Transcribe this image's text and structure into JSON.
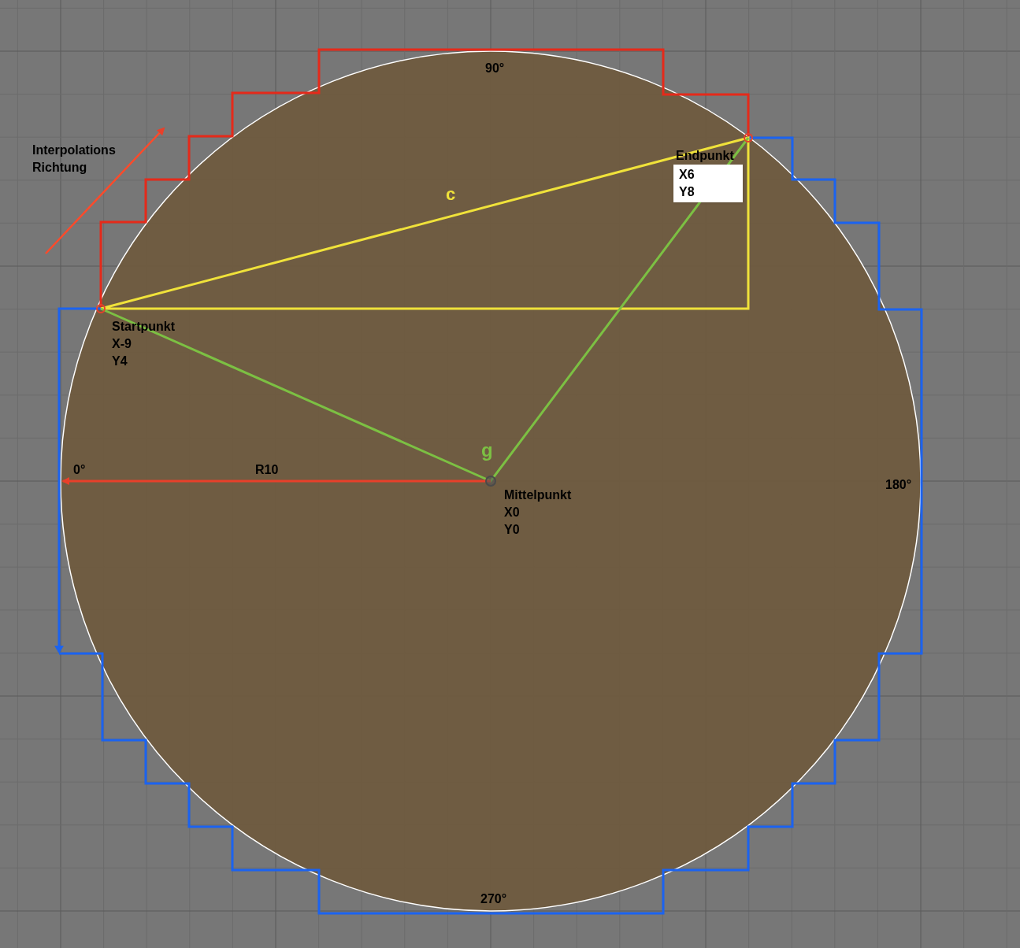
{
  "canvas": {
    "angle_labels": [
      "90°",
      "180°",
      "270°",
      "0°"
    ],
    "radius_label": "R10",
    "chord_label": "c",
    "angle_label": "g",
    "direction_label": [
      "Interpolations",
      "Richtung"
    ],
    "points": [
      {
        "kind": "start",
        "name": "Startpunkt",
        "x": "X-9",
        "y": "Y4"
      },
      {
        "kind": "end",
        "name": "Endpunkt",
        "x": "X6",
        "y": "Y8"
      },
      {
        "kind": "center",
        "name": "Mittelpunkt",
        "x": "X0",
        "y": "Y0"
      }
    ]
  }
}
